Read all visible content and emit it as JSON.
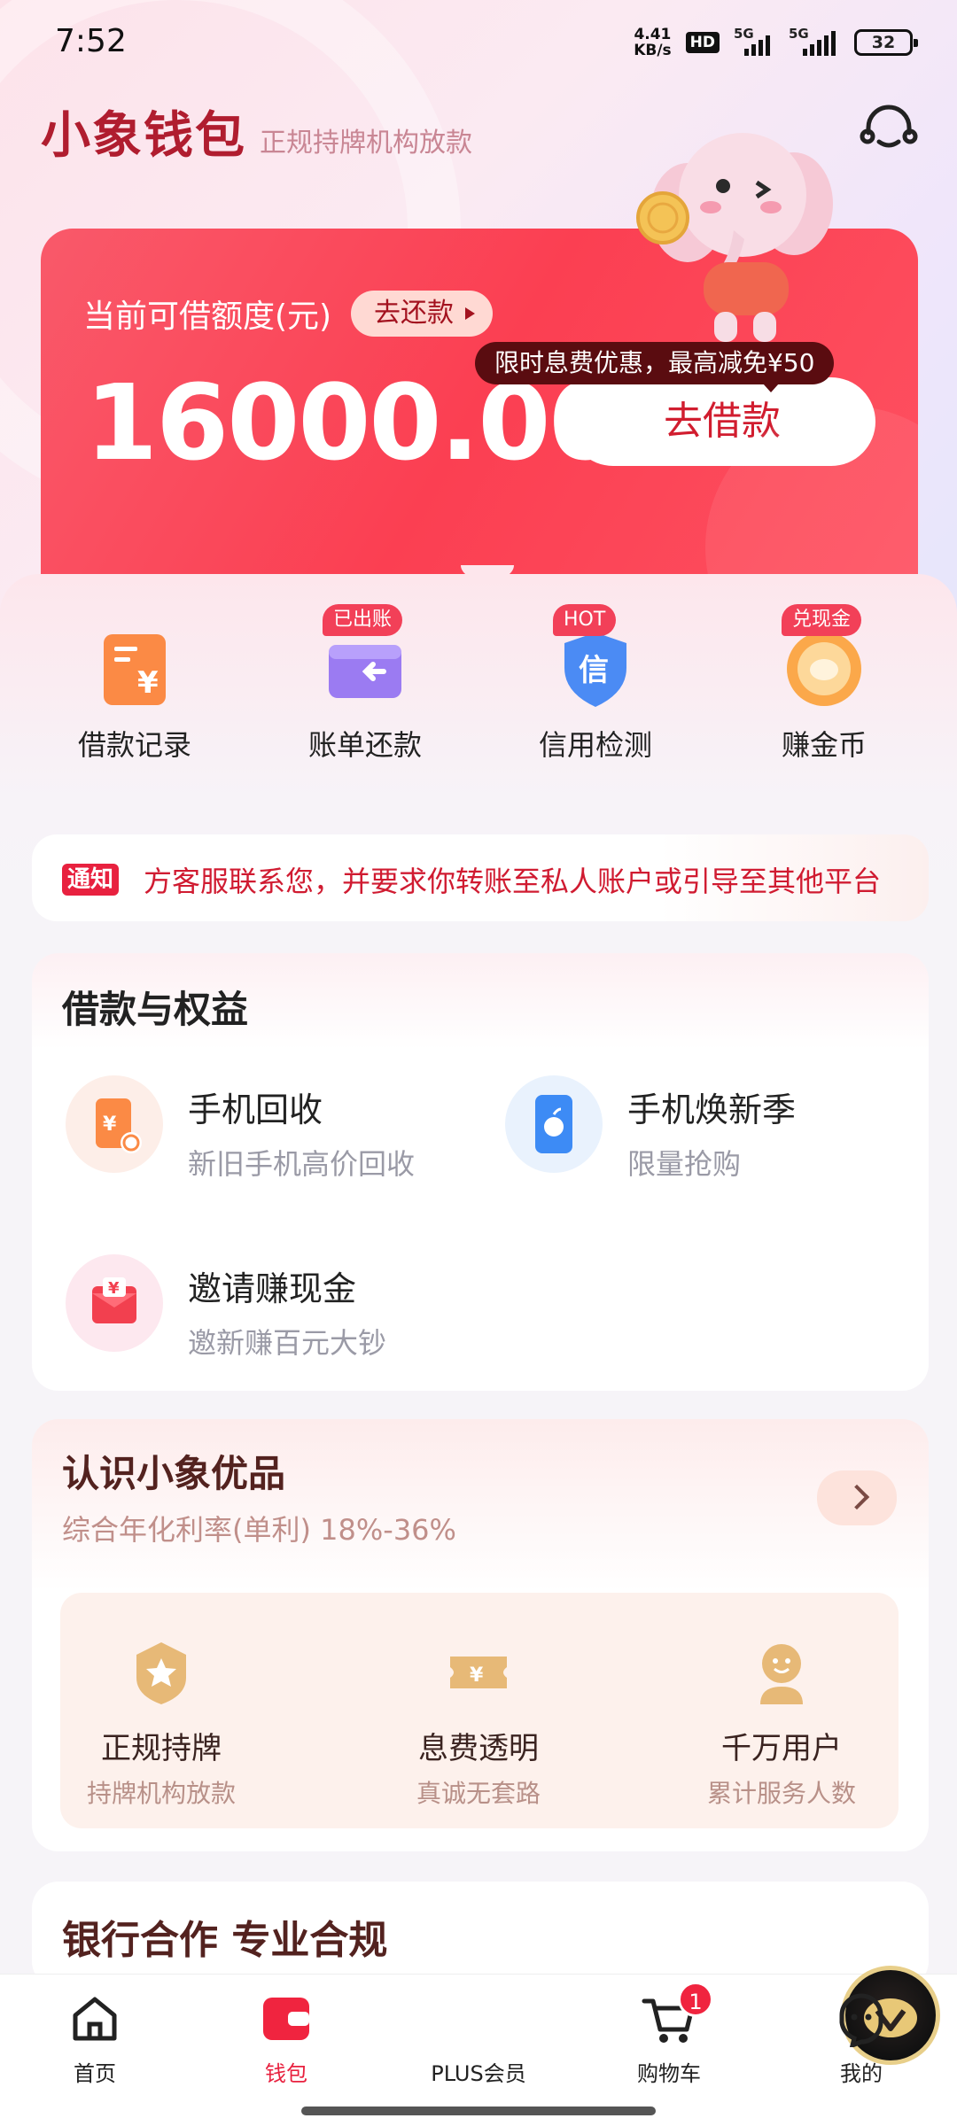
{
  "status_bar": {
    "time": "7:52",
    "net_speed_value": "4.41",
    "net_speed_unit": "KB/s",
    "hd": "HD",
    "signal1": "5G",
    "signal2": "5G",
    "battery": "32"
  },
  "header": {
    "brand": "小象钱包",
    "subtitle": "正规持牌机构放款"
  },
  "credit": {
    "label": "当前可借额度(元)",
    "repay_label": "去还款",
    "amount": "16000.00",
    "promo": "限时息费优惠，最高减免¥50",
    "borrow_label": "去借款"
  },
  "actions": [
    {
      "label": "借款记录",
      "tag": ""
    },
    {
      "label": "账单还款",
      "tag": "已出账"
    },
    {
      "label": "信用检测",
      "tag": "HOT"
    },
    {
      "label": "赚金币",
      "tag": "兑现金"
    }
  ],
  "notice": {
    "tag": "通知",
    "text": "方客服联系您，并要求你转账至私人账户或引导至其他平台"
  },
  "loan_benefits": {
    "title": "借款与权益",
    "items": [
      {
        "title": "手机回收",
        "sub": "新旧手机高价回收"
      },
      {
        "title": "手机焕新季",
        "sub": "限量抢购"
      },
      {
        "title": "邀请赚现金",
        "sub": "邀新赚百元大钞"
      }
    ]
  },
  "know": {
    "title": "认识小象优品",
    "sub": "综合年化利率(单利) 18%-36%",
    "features": [
      {
        "title": "正规持牌",
        "sub": "持牌机构放款"
      },
      {
        "title": "息费透明",
        "sub": "真诚无套路"
      },
      {
        "title": "千万用户",
        "sub": "累计服务人数"
      }
    ]
  },
  "bank": {
    "title": "银行合作 专业合规"
  },
  "nav": {
    "items": [
      {
        "label": "首页"
      },
      {
        "label": "钱包"
      },
      {
        "label": "PLUS会员"
      },
      {
        "label": "购物车"
      },
      {
        "label": "我的"
      }
    ],
    "cart_count": "1"
  },
  "colors": {
    "brand_red": "#e8213f",
    "card_red": "#fb3f52"
  }
}
